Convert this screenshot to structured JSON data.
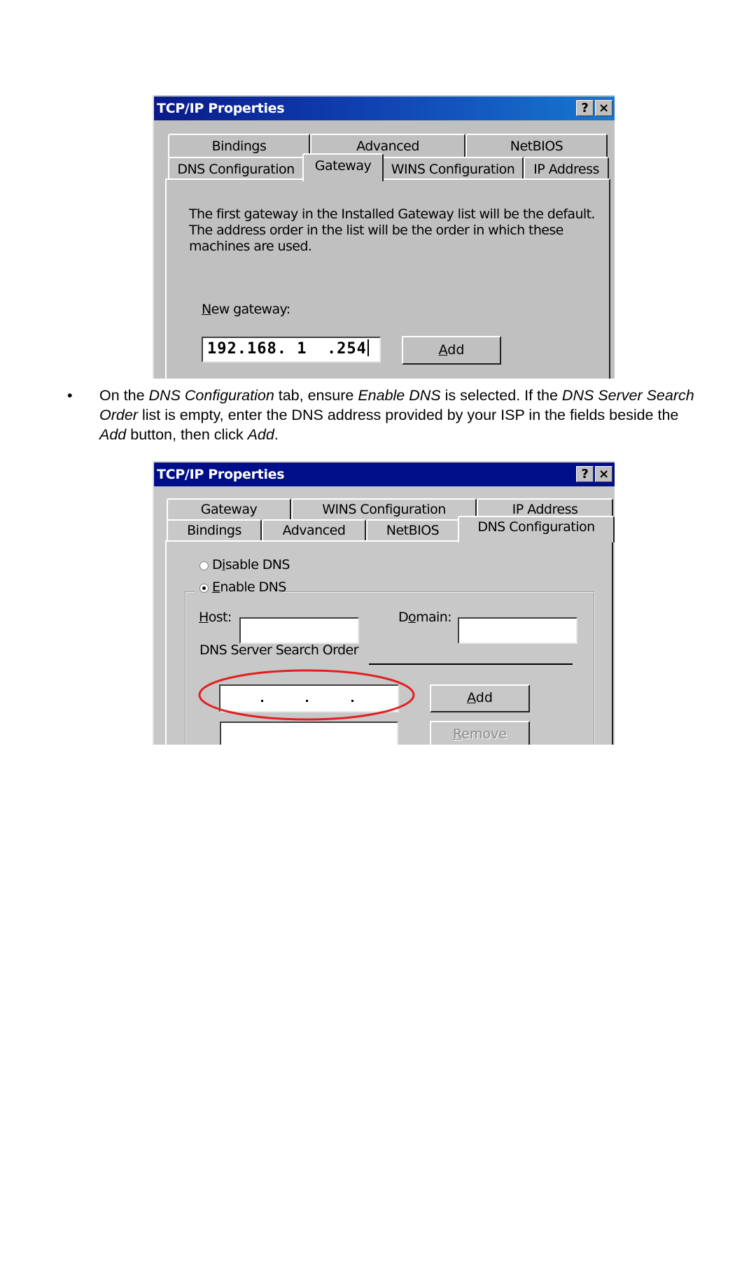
{
  "dialog1": {
    "title": "TCP/IP Properties",
    "help_button": "?",
    "close_button": "×",
    "tabs_top_row": [
      "Bindings",
      "Advanced",
      "NetBIOS"
    ],
    "tabs_bottom_row": [
      "DNS Configuration",
      "Gateway",
      "WINS Configuration",
      "IP Address"
    ],
    "selected_tab": "Gateway",
    "description_lines": [
      "The first gateway in the Installed Gateway list will be the default.",
      "The address order in the list will be the order in which these",
      "machines are used."
    ],
    "new_gateway_label_accel": "N",
    "new_gateway_label_rest": "ew gateway:",
    "new_gateway_value": "192.168. 1  .254",
    "add_button_accel": "A",
    "add_button_rest": "dd"
  },
  "instruction": {
    "bullet": "•",
    "parts": [
      {
        "text": "On the ",
        "italic": false
      },
      {
        "text": "DNS Configuration",
        "italic": true
      },
      {
        "text": " tab, ensure ",
        "italic": false
      },
      {
        "text": "Enable DNS",
        "italic": true
      },
      {
        "text": " is selected. If the ",
        "italic": false
      },
      {
        "text": "DNS Server Search Order",
        "italic": true
      },
      {
        "text": " list is empty, enter the DNS address provided by your ISP in the fields beside the ",
        "italic": false
      },
      {
        "text": "Add",
        "italic": true
      },
      {
        "text": " button, then click ",
        "italic": false
      },
      {
        "text": "Add",
        "italic": true
      },
      {
        "text": ".",
        "italic": false
      }
    ]
  },
  "dialog2": {
    "title": "TCP/IP Properties",
    "help_button": "?",
    "close_button": "×",
    "tabs_top_row": [
      "Gateway",
      "WINS Configuration",
      "IP Address"
    ],
    "tabs_bottom_row": [
      "Bindings",
      "Advanced",
      "NetBIOS",
      "DNS Configuration"
    ],
    "selected_tab": "DNS Configuration",
    "disable_dns_pre": "D",
    "disable_dns_accel": "i",
    "disable_dns_rest": "sable DNS",
    "disable_dns_checked": false,
    "enable_dns_accel": "E",
    "enable_dns_rest": "nable DNS",
    "enable_dns_checked": true,
    "host_label_accel": "H",
    "host_label_rest": "ost:",
    "host_value": "",
    "domain_label_pre": "D",
    "domain_label_accel": "o",
    "domain_label_rest": "main:",
    "domain_value": "",
    "search_order_label": "DNS Server Search Order",
    "dns_ip_value": [
      "",
      "",
      "",
      ""
    ],
    "add_button_accel": "A",
    "add_button_rest": "dd",
    "remove_button_accel": "R",
    "remove_button_rest": "emove",
    "remove_enabled": false,
    "search_order_list": [],
    "annotation_color": "#e02020"
  }
}
